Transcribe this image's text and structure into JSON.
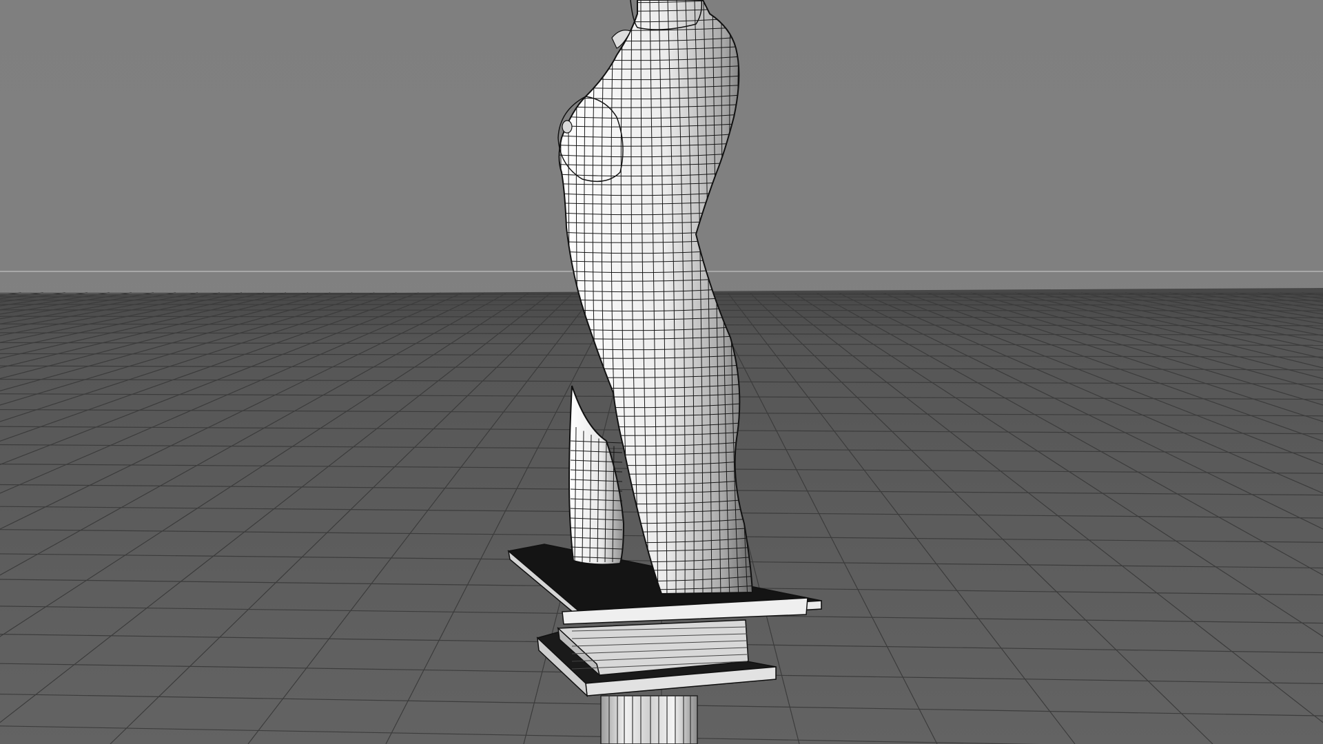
{
  "viewport": {
    "mode": "wireframe-on-shaded",
    "projection": "perspective",
    "grid_visible": true
  },
  "scene": {
    "objects": [
      {
        "name": "torso",
        "type": "polygon-mesh",
        "material": "white-clay",
        "wireframe": true
      },
      {
        "name": "pedestal",
        "type": "polygon-mesh",
        "material": "white-clay"
      }
    ]
  },
  "colors": {
    "background_top": "#7f7f7f",
    "background_bottom": "#838383",
    "floor": "#5e5e5e",
    "floor_far": "#4a4a4a",
    "grid_line": "#3c3c3c",
    "horizon_line": "#b5b5b5",
    "mesh_fill": "#f4f4f4",
    "mesh_shade": "#9a9a9a",
    "mesh_wire": "#151515",
    "pedestal_top": "#141414",
    "pedestal_face": "#e6e6e6"
  },
  "icons": {
    "viewport_camera": "camera-icon"
  }
}
